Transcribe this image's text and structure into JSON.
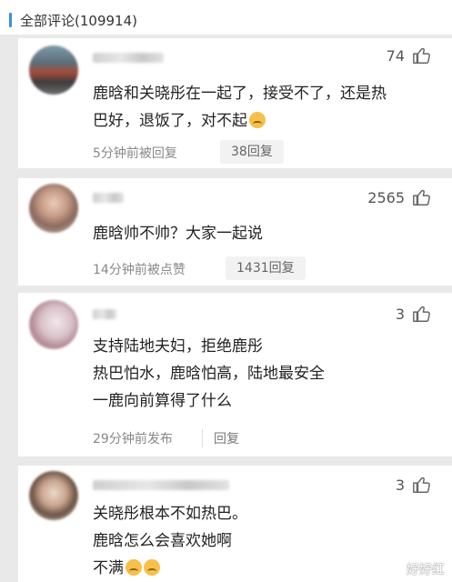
{
  "header": {
    "title": "全部评论(109914)"
  },
  "comments": [
    {
      "likes": "74",
      "lines": [
        "鹿晗和关晓彤在一起了，接受不了，还是热",
        "巴好，退饭了，对不起"
      ],
      "emoji": "sad-face",
      "meta": "5分钟前被回复",
      "reply": "38回复"
    },
    {
      "likes": "2565",
      "lines": [
        "鹿晗帅不帅？大家一起说"
      ],
      "meta": "14分钟前被点赞",
      "reply": "1431回复"
    },
    {
      "likes": "3",
      "lines": [
        "支持陆地夫妇，拒绝鹿彤",
        "热巴怕水，鹿晗怕高，陆地最安全",
        "一鹿向前算得了什么"
      ],
      "meta": "29分钟前发布",
      "reply": "回复"
    },
    {
      "likes": "3",
      "lines": [
        "关晓彤根本不如热巴。",
        "鹿晗怎么会喜欢她啊",
        "不满"
      ],
      "emoji": "crying-face"
    }
  ],
  "watermark": "好好红",
  "colors": {
    "accent": "#3b8ee6",
    "background": "#e9e9e9",
    "card": "#ffffff",
    "meta_text": "#888888"
  }
}
